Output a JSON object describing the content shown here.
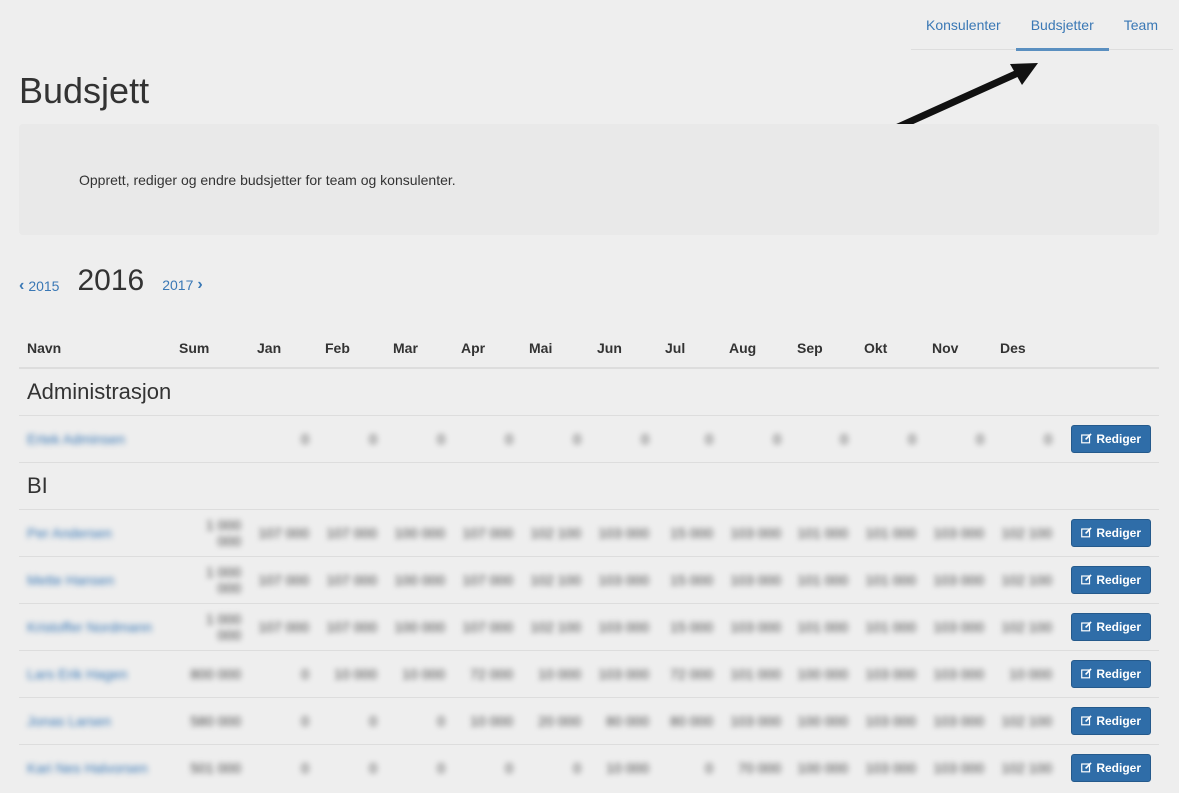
{
  "nav": {
    "tabs": [
      {
        "label": "Konsulenter"
      },
      {
        "label": "Budsjetter",
        "active": true
      },
      {
        "label": "Team"
      }
    ]
  },
  "page": {
    "title": "Budsjett",
    "intro": "Opprett, rediger og endre budsjetter for team og konsulenter."
  },
  "years": {
    "prev": "2015",
    "current": "2016",
    "next": "2017"
  },
  "table": {
    "headers": [
      "Navn",
      "Sum",
      "Jan",
      "Feb",
      "Mar",
      "Apr",
      "Mai",
      "Jun",
      "Jul",
      "Aug",
      "Sep",
      "Okt",
      "Nov",
      "Des"
    ],
    "edit_label": "Rediger",
    "groups": [
      {
        "name": "Administrasjon",
        "rows": [
          {
            "name": "Ertek Adminsen",
            "values": [
              "",
              "0",
              "0",
              "0",
              "0",
              "0",
              "0",
              "0",
              "0",
              "0",
              "0",
              "0",
              "0"
            ]
          }
        ]
      },
      {
        "name": "BI",
        "rows": [
          {
            "name": "Per Andersen",
            "values": [
              "1 000 000",
              "107 000",
              "107 000",
              "100 000",
              "107 000",
              "102 100",
              "103 000",
              "15 000",
              "103 000",
              "101 000",
              "101 000",
              "103 000",
              "102 100"
            ]
          },
          {
            "name": "Mette Hansen",
            "values": [
              "1 000 000",
              "107 000",
              "107 000",
              "100 000",
              "107 000",
              "102 100",
              "103 000",
              "15 000",
              "103 000",
              "101 000",
              "101 000",
              "103 000",
              "102 100"
            ]
          },
          {
            "name": "Kristoffer Nordmann",
            "values": [
              "1 000 000",
              "107 000",
              "107 000",
              "100 000",
              "107 000",
              "102 100",
              "103 000",
              "15 000",
              "103 000",
              "101 000",
              "101 000",
              "103 000",
              "102 100"
            ]
          },
          {
            "name": "Lars Erik Hagen",
            "values": [
              "800 000",
              "0",
              "10 000",
              "10 000",
              "72 000",
              "10 000",
              "103 000",
              "72 000",
              "101 000",
              "100 000",
              "103 000",
              "103 000",
              "10 000"
            ]
          },
          {
            "name": "Jonas Larsen",
            "values": [
              "580 000",
              "0",
              "0",
              "0",
              "10 000",
              "20 000",
              "80 000",
              "80 000",
              "103 000",
              "100 000",
              "103 000",
              "103 000",
              "102 100"
            ]
          },
          {
            "name": "Kari Nes Halvorsen",
            "values": [
              "501 000",
              "0",
              "0",
              "0",
              "0",
              "0",
              "10 000",
              "0",
              "70 000",
              "100 000",
              "103 000",
              "103 000",
              "102 100"
            ]
          }
        ]
      }
    ]
  }
}
